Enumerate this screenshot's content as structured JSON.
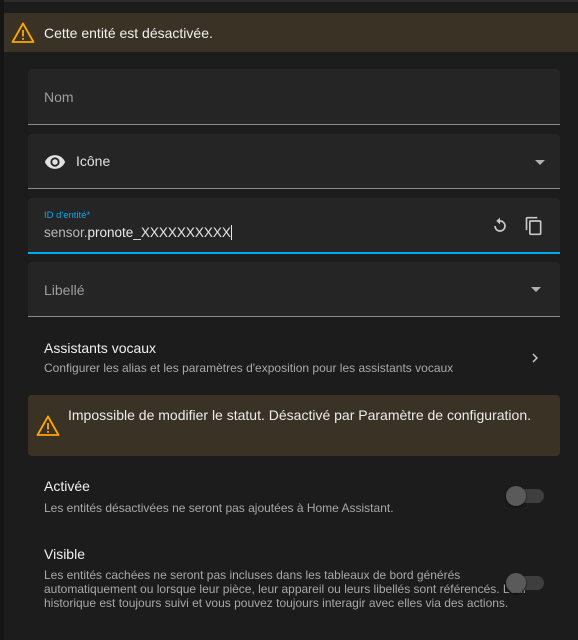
{
  "banner": {
    "text": "Cette entité est désactivée."
  },
  "fields": {
    "name": {
      "placeholder": "Nom"
    },
    "icon": {
      "label": "Icône"
    },
    "entity_id": {
      "label": "ID d'entité*",
      "prefix": "sensor.",
      "value": "pronote_XXXXXXXXXX"
    },
    "label": {
      "placeholder": "Libellé"
    }
  },
  "voice_assistants": {
    "title": "Assistants vocaux",
    "description": "Configurer les alias et les paramètres d'exposition pour les assistants vocaux"
  },
  "status_alert": {
    "text": "Impossible de modifier le statut. Désactivé par Paramètre de configuration."
  },
  "enabled": {
    "title": "Activée",
    "description": "Les entités désactivées ne seront pas ajoutées à Home Assistant.",
    "state": false
  },
  "visible": {
    "title": "Visible",
    "description": "Les entités cachées ne seront pas incluses dans les tableaux de bord générés automatiquement ou lorsque leur pièce, leur appareil ou leurs libellés sont référencés. Leur historique est toujours suivi et vous pouvez toujours interagir avec elles via des actions.",
    "state": false
  },
  "colors": {
    "accent": "#03a9f4",
    "warning": "#ffa600",
    "warning_bg": "#3a3325"
  },
  "icons": {
    "banner": "warning-icon",
    "icon_field": "eye-icon",
    "reset": "restore-icon",
    "copy": "copy-icon",
    "voice_chevron": "chevron-right-icon",
    "alert": "warning-icon"
  }
}
